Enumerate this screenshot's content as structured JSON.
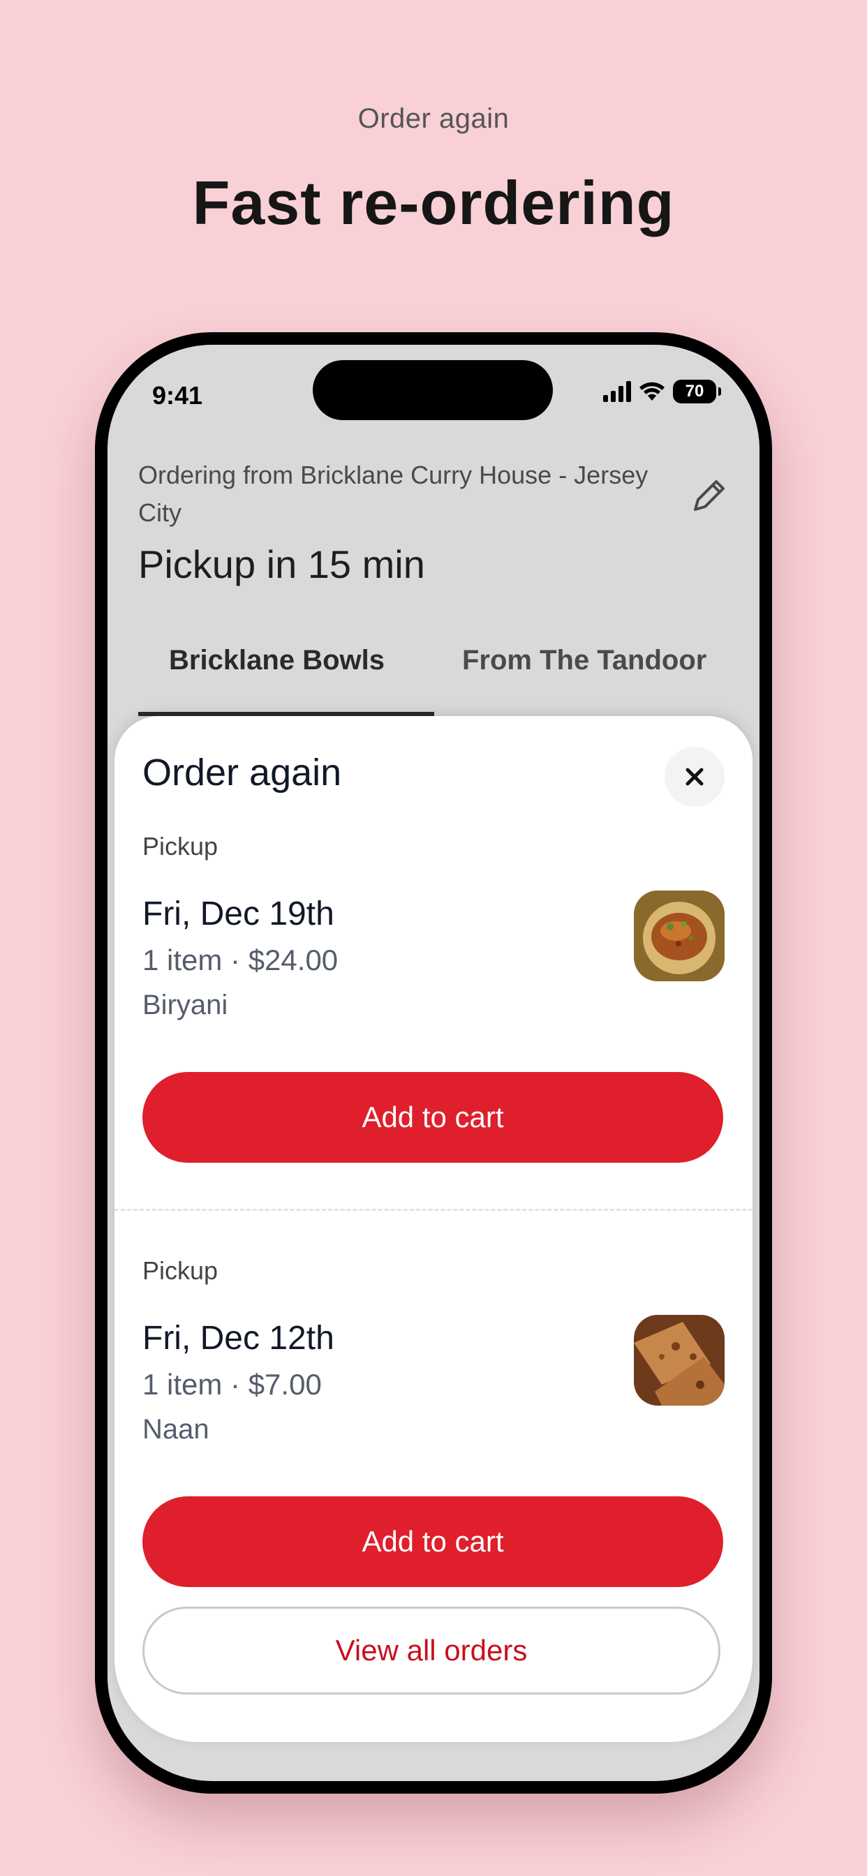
{
  "hero": {
    "kicker": "Order again",
    "title": "Fast re-ordering"
  },
  "status_bar": {
    "time": "9:41",
    "battery": "70",
    "icons": [
      "cellular-signal-icon",
      "wifi-icon",
      "battery-icon"
    ]
  },
  "store": {
    "ordering_from": "Ordering from Bricklane Curry House - Jersey City",
    "pickup_time": "Pickup in 15 min",
    "edit_icon": "pencil-icon"
  },
  "menu_tabs": [
    {
      "label": "Bricklane Bowls",
      "active": true
    },
    {
      "label": "From The Tandoor",
      "active": false
    }
  ],
  "sheet": {
    "title": "Order again",
    "close_icon": "close-icon",
    "orders": [
      {
        "type": "Pickup",
        "date": "Fri, Dec 19th",
        "summary": "1 item · $24.00",
        "items": "Biryani",
        "thumbnail": "biryani-photo",
        "cta": "Add to cart"
      },
      {
        "type": "Pickup",
        "date": "Fri, Dec 12th",
        "summary": "1 item · $7.00",
        "items": "Naan",
        "thumbnail": "naan-photo",
        "cta": "Add to cart"
      }
    ],
    "view_all": "View all orders"
  },
  "colors": {
    "background": "#f8d0d5",
    "primary": "#df1f2c",
    "link": "#c8101e"
  }
}
